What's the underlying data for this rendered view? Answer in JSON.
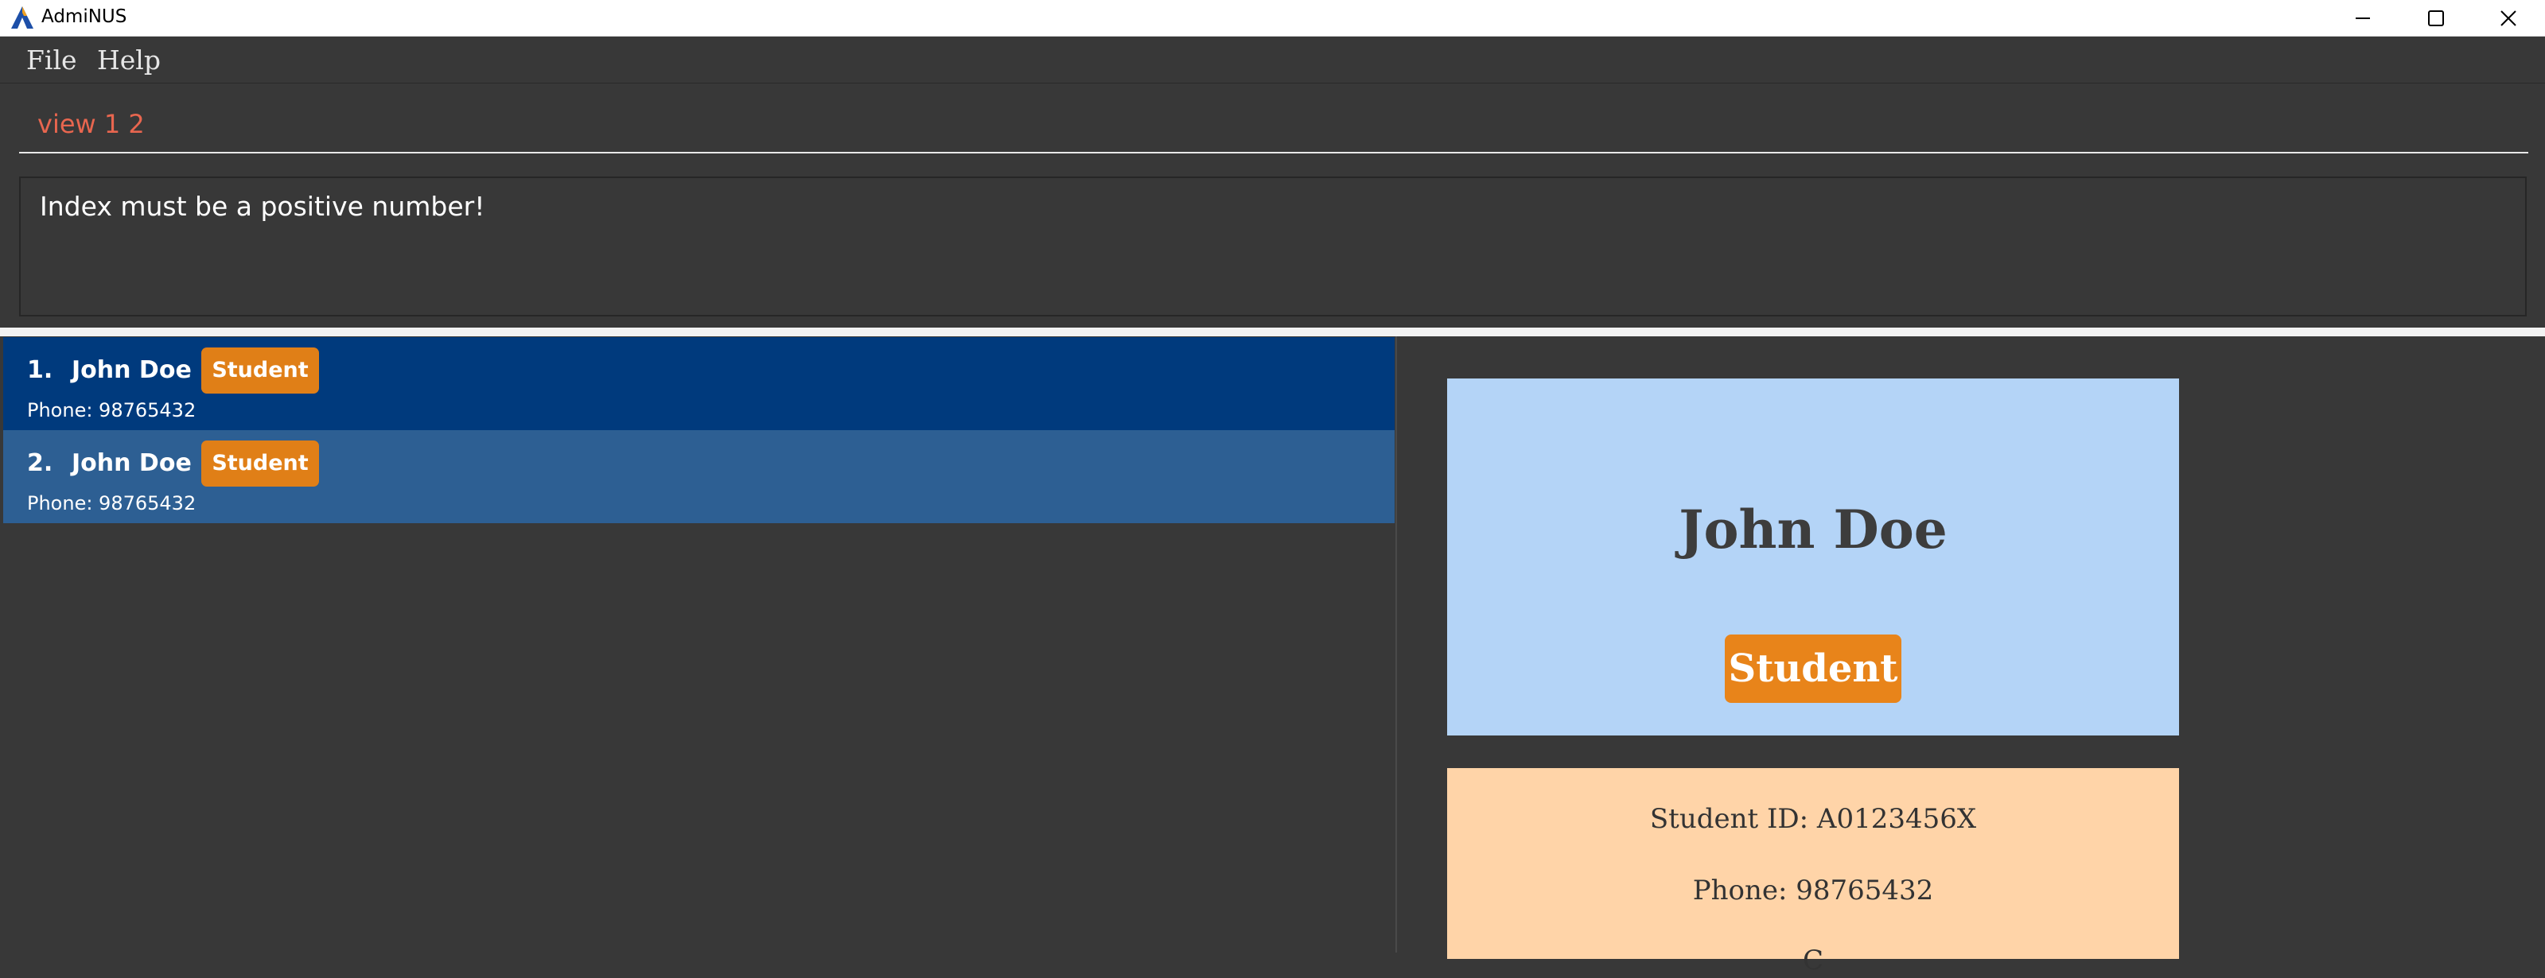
{
  "window": {
    "title": "AdmiNUS",
    "controls": {
      "minimize_icon": "minimize-icon",
      "maximize_icon": "maximize-icon",
      "close_icon": "close-icon"
    }
  },
  "menu": {
    "file": "File",
    "help": "Help"
  },
  "command": {
    "value": "view 1 2"
  },
  "result": {
    "text": "Index must be a positive number!"
  },
  "persons": [
    {
      "index": "1.",
      "name": "John Doe",
      "tag": "Student",
      "phone": "Phone: 98765432"
    },
    {
      "index": "2.",
      "name": "John Doe",
      "tag": "Student",
      "phone": "Phone: 98765432"
    }
  ],
  "detail": {
    "name": "John Doe",
    "tag": "Student",
    "student_id": "Student ID: A0123456X",
    "phone": "Phone: 98765432",
    "next_line": "C"
  },
  "colors": {
    "background": "#383838",
    "selected_row": "#003a7d",
    "row": "#2d5f93",
    "tag": "#e07f17",
    "detail_header": "#b4d4f7",
    "detail_info": "#ffd4a8",
    "command_text": "#e8664f"
  }
}
